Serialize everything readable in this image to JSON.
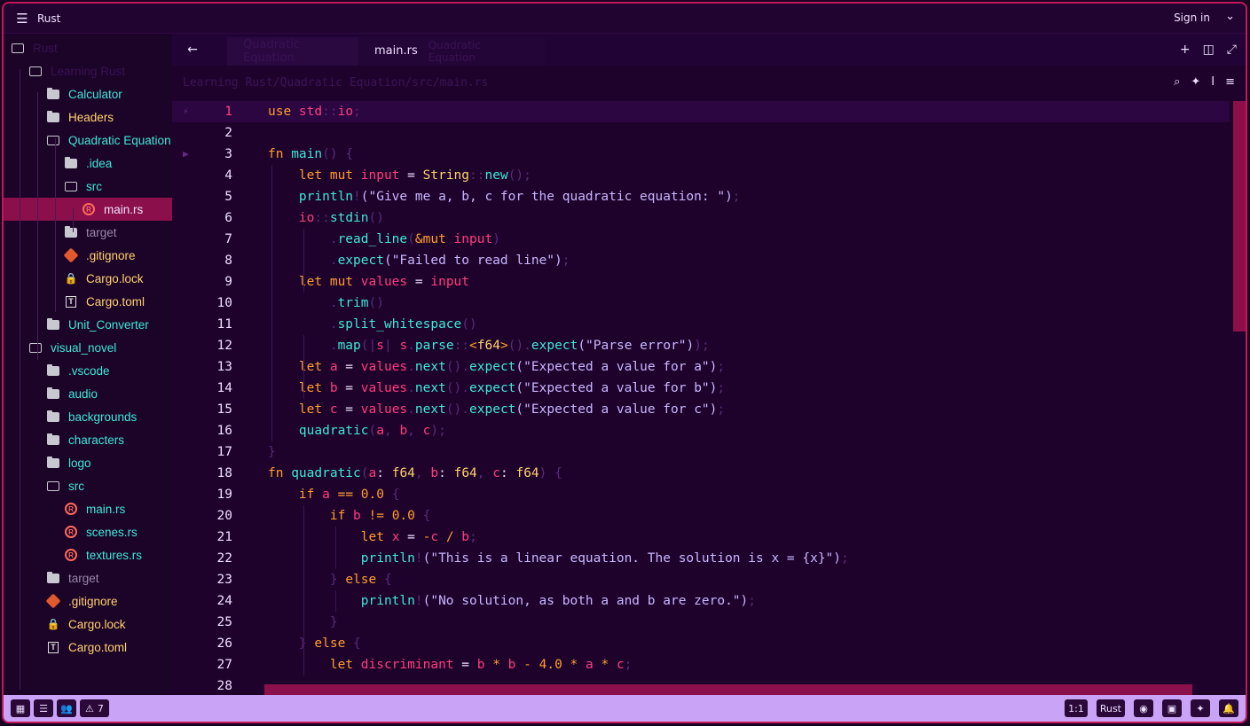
{
  "titlebar": {
    "project": "Rust",
    "signin": "Sign in"
  },
  "sidebar": {
    "items": [
      {
        "label": "Rust",
        "depth": 0,
        "kind": "folder-open",
        "color": "#3a1254"
      },
      {
        "label": "Learning Rust",
        "depth": 1,
        "kind": "folder-open",
        "color": "#3a1254"
      },
      {
        "label": "Calculator",
        "depth": 2,
        "kind": "folder",
        "color": "#3ee8d8"
      },
      {
        "label": "Headers",
        "depth": 2,
        "kind": "folder",
        "color": "#ffd36e"
      },
      {
        "label": "Quadratic Equation",
        "depth": 2,
        "kind": "folder-open",
        "color": "#3ee8d8"
      },
      {
        "label": ".idea",
        "depth": 3,
        "kind": "folder",
        "color": "#3ee8d8"
      },
      {
        "label": "src",
        "depth": 3,
        "kind": "folder-open",
        "color": "#3ee8d8"
      },
      {
        "label": "main.rs",
        "depth": 4,
        "kind": "rust",
        "color": "#f0e0ff"
      },
      {
        "label": "target",
        "depth": 3,
        "kind": "folder",
        "color": "#9a8aa8"
      },
      {
        "label": ".gitignore",
        "depth": 3,
        "kind": "git",
        "color": "#ffd36e"
      },
      {
        "label": "Cargo.lock",
        "depth": 3,
        "kind": "lock",
        "color": "#ffd36e"
      },
      {
        "label": "Cargo.toml",
        "depth": 3,
        "kind": "toml",
        "color": "#ffd36e"
      },
      {
        "label": "Unit_Converter",
        "depth": 2,
        "kind": "folder",
        "color": "#3ee8d8"
      },
      {
        "label": "visual_novel",
        "depth": 1,
        "kind": "folder-open",
        "color": "#3ee8d8"
      },
      {
        "label": ".vscode",
        "depth": 2,
        "kind": "folder",
        "color": "#3ee8d8"
      },
      {
        "label": "audio",
        "depth": 2,
        "kind": "folder",
        "color": "#3ee8d8"
      },
      {
        "label": "backgrounds",
        "depth": 2,
        "kind": "folder",
        "color": "#3ee8d8"
      },
      {
        "label": "characters",
        "depth": 2,
        "kind": "folder",
        "color": "#3ee8d8"
      },
      {
        "label": "logo",
        "depth": 2,
        "kind": "folder",
        "color": "#3ee8d8"
      },
      {
        "label": "src",
        "depth": 2,
        "kind": "folder-open",
        "color": "#3ee8d8"
      },
      {
        "label": "main.rs",
        "depth": 3,
        "kind": "rust",
        "color": "#3ee8d8"
      },
      {
        "label": "scenes.rs",
        "depth": 3,
        "kind": "rust",
        "color": "#3ee8d8"
      },
      {
        "label": "textures.rs",
        "depth": 3,
        "kind": "rust",
        "color": "#3ee8d8"
      },
      {
        "label": "target",
        "depth": 2,
        "kind": "folder",
        "color": "#9a8aa8"
      },
      {
        "label": ".gitignore",
        "depth": 2,
        "kind": "git",
        "color": "#ffd36e"
      },
      {
        "label": "Cargo.lock",
        "depth": 2,
        "kind": "lock",
        "color": "#ffd36e"
      },
      {
        "label": "Cargo.toml",
        "depth": 2,
        "kind": "toml",
        "color": "#ffd36e"
      }
    ],
    "selected_index": 7
  },
  "tabs": {
    "inactive": "Quadratic Equation",
    "active": "main.rs",
    "active_ghost": "Quadratic Equation"
  },
  "breadcrumb": "Learning Rust/Quadratic Equation/src/main.rs",
  "editor": {
    "current_line": 1,
    "lines": [
      [
        [
          "kw",
          "use "
        ],
        [
          "id",
          "std"
        ],
        [
          "pu",
          "::"
        ],
        [
          "id",
          "io"
        ],
        [
          "pu",
          ";"
        ]
      ],
      [],
      [
        [
          "kw",
          "fn "
        ],
        [
          "fn",
          "main"
        ],
        [
          "pu",
          "() {"
        ]
      ],
      [
        [
          "pl",
          "    "
        ],
        [
          "kw",
          "let mut "
        ],
        [
          "id",
          "input"
        ],
        [
          "pl",
          " = "
        ],
        [
          "ty",
          "String"
        ],
        [
          "pu",
          "::"
        ],
        [
          "fn",
          "new"
        ],
        [
          "pu",
          "();"
        ]
      ],
      [
        [
          "pl",
          "    "
        ],
        [
          "fn",
          "println"
        ],
        [
          "pu",
          "!"
        ],
        [
          "st",
          "(\"Give me a, b, c for the quadratic equation: \")"
        ],
        [
          "pu",
          ";"
        ]
      ],
      [
        [
          "pl",
          "    "
        ],
        [
          "id",
          "io"
        ],
        [
          "pu",
          "::"
        ],
        [
          "fn",
          "stdin"
        ],
        [
          "pu",
          "()"
        ]
      ],
      [
        [
          "pl",
          "        "
        ],
        [
          "pu",
          "."
        ],
        [
          "fn",
          "read_line"
        ],
        [
          "pu",
          "("
        ],
        [
          "op",
          "&"
        ],
        [
          "kw",
          "mut "
        ],
        [
          "id",
          "input"
        ],
        [
          "pu",
          ")"
        ]
      ],
      [
        [
          "pl",
          "        "
        ],
        [
          "pu",
          "."
        ],
        [
          "fn",
          "expect"
        ],
        [
          "st",
          "(\"Failed to read line\")"
        ],
        [
          "pu",
          ";"
        ]
      ],
      [
        [
          "pl",
          "    "
        ],
        [
          "kw",
          "let mut "
        ],
        [
          "id",
          "values"
        ],
        [
          "pl",
          " = "
        ],
        [
          "id",
          "input"
        ]
      ],
      [
        [
          "pl",
          "        "
        ],
        [
          "pu",
          "."
        ],
        [
          "fn",
          "trim"
        ],
        [
          "pu",
          "()"
        ]
      ],
      [
        [
          "pl",
          "        "
        ],
        [
          "pu",
          "."
        ],
        [
          "fn",
          "split_whitespace"
        ],
        [
          "pu",
          "()"
        ]
      ],
      [
        [
          "pl",
          "        "
        ],
        [
          "pu",
          "."
        ],
        [
          "fn",
          "map"
        ],
        [
          "pu",
          "(|"
        ],
        [
          "id",
          "s"
        ],
        [
          "pu",
          "| "
        ],
        [
          "id",
          "s"
        ],
        [
          "pu",
          "."
        ],
        [
          "fn",
          "parse"
        ],
        [
          "pu",
          "::"
        ],
        [
          "op",
          "<"
        ],
        [
          "ty",
          "f64"
        ],
        [
          "op",
          ">"
        ],
        [
          "pu",
          "()."
        ],
        [
          "fn",
          "expect"
        ],
        [
          "st",
          "(\"Parse error\")"
        ],
        [
          "pu",
          ");"
        ]
      ],
      [
        [
          "pl",
          "    "
        ],
        [
          "kw",
          "let "
        ],
        [
          "id",
          "a"
        ],
        [
          "pl",
          " = "
        ],
        [
          "id",
          "values"
        ],
        [
          "pu",
          "."
        ],
        [
          "fn",
          "next"
        ],
        [
          "pu",
          "()."
        ],
        [
          "fn",
          "expect"
        ],
        [
          "st",
          "(\"Expected a value for a\")"
        ],
        [
          "pu",
          ";"
        ]
      ],
      [
        [
          "pl",
          "    "
        ],
        [
          "kw",
          "let "
        ],
        [
          "id",
          "b"
        ],
        [
          "pl",
          " = "
        ],
        [
          "id",
          "values"
        ],
        [
          "pu",
          "."
        ],
        [
          "fn",
          "next"
        ],
        [
          "pu",
          "()."
        ],
        [
          "fn",
          "expect"
        ],
        [
          "st",
          "(\"Expected a value for b\")"
        ],
        [
          "pu",
          ";"
        ]
      ],
      [
        [
          "pl",
          "    "
        ],
        [
          "kw",
          "let "
        ],
        [
          "id",
          "c"
        ],
        [
          "pl",
          " = "
        ],
        [
          "id",
          "values"
        ],
        [
          "pu",
          "."
        ],
        [
          "fn",
          "next"
        ],
        [
          "pu",
          "()."
        ],
        [
          "fn",
          "expect"
        ],
        [
          "st",
          "(\"Expected a value for c\")"
        ],
        [
          "pu",
          ";"
        ]
      ],
      [
        [
          "pl",
          "    "
        ],
        [
          "fn",
          "quadratic"
        ],
        [
          "pu",
          "("
        ],
        [
          "id",
          "a"
        ],
        [
          "pu",
          ", "
        ],
        [
          "id",
          "b"
        ],
        [
          "pu",
          ", "
        ],
        [
          "id",
          "c"
        ],
        [
          "pu",
          ");"
        ]
      ],
      [
        [
          "pu",
          "}"
        ]
      ],
      [
        [
          "kw",
          "fn "
        ],
        [
          "fn",
          "quadratic"
        ],
        [
          "pu",
          "("
        ],
        [
          "id",
          "a"
        ],
        [
          "pl",
          ": "
        ],
        [
          "ty",
          "f64"
        ],
        [
          "pu",
          ", "
        ],
        [
          "id",
          "b"
        ],
        [
          "pl",
          ": "
        ],
        [
          "ty",
          "f64"
        ],
        [
          "pu",
          ", "
        ],
        [
          "id",
          "c"
        ],
        [
          "pl",
          ": "
        ],
        [
          "ty",
          "f64"
        ],
        [
          "pu",
          ") {"
        ]
      ],
      [
        [
          "pl",
          "    "
        ],
        [
          "kw",
          "if "
        ],
        [
          "id",
          "a"
        ],
        [
          "op",
          " == "
        ],
        [
          "num",
          "0.0"
        ],
        [
          "pu",
          " {"
        ]
      ],
      [
        [
          "pl",
          "        "
        ],
        [
          "kw",
          "if "
        ],
        [
          "id",
          "b"
        ],
        [
          "op",
          " != "
        ],
        [
          "num",
          "0.0"
        ],
        [
          "pu",
          " {"
        ]
      ],
      [
        [
          "pl",
          "            "
        ],
        [
          "kw",
          "let "
        ],
        [
          "id",
          "x"
        ],
        [
          "pl",
          " = "
        ],
        [
          "op",
          "-"
        ],
        [
          "id",
          "c"
        ],
        [
          "op",
          " / "
        ],
        [
          "id",
          "b"
        ],
        [
          "pu",
          ";"
        ]
      ],
      [
        [
          "pl",
          "            "
        ],
        [
          "fn",
          "println"
        ],
        [
          "pu",
          "!"
        ],
        [
          "st",
          "(\"This is a linear equation. The solution is x = {x}\")"
        ],
        [
          "pu",
          ";"
        ]
      ],
      [
        [
          "pl",
          "        "
        ],
        [
          "pu",
          "} "
        ],
        [
          "kw",
          "else "
        ],
        [
          "pu",
          "{"
        ]
      ],
      [
        [
          "pl",
          "            "
        ],
        [
          "fn",
          "println"
        ],
        [
          "pu",
          "!"
        ],
        [
          "st",
          "(\"No solution, as both a and b are zero.\")"
        ],
        [
          "pu",
          ";"
        ]
      ],
      [
        [
          "pl",
          "        "
        ],
        [
          "pu",
          "}"
        ]
      ],
      [
        [
          "pl",
          "    "
        ],
        [
          "pu",
          "} "
        ],
        [
          "kw",
          "else "
        ],
        [
          "pu",
          "{"
        ]
      ],
      [
        [
          "pl",
          "        "
        ],
        [
          "kw",
          "let "
        ],
        [
          "id",
          "discriminant"
        ],
        [
          "pl",
          " = "
        ],
        [
          "id",
          "b"
        ],
        [
          "op",
          " * "
        ],
        [
          "id",
          "b"
        ],
        [
          "op",
          " - "
        ],
        [
          "num",
          "4.0"
        ],
        [
          "op",
          " * "
        ],
        [
          "id",
          "a"
        ],
        [
          "op",
          " * "
        ],
        [
          "id",
          "c"
        ],
        [
          "pu",
          ";"
        ]
      ],
      []
    ]
  },
  "statusbar": {
    "warnings": "7",
    "cursor": "1:1",
    "language": "Rust"
  },
  "colors": {
    "accent": "#c2185b",
    "selection": "#8a0f4a",
    "status_bg": "#c9a3f5"
  }
}
